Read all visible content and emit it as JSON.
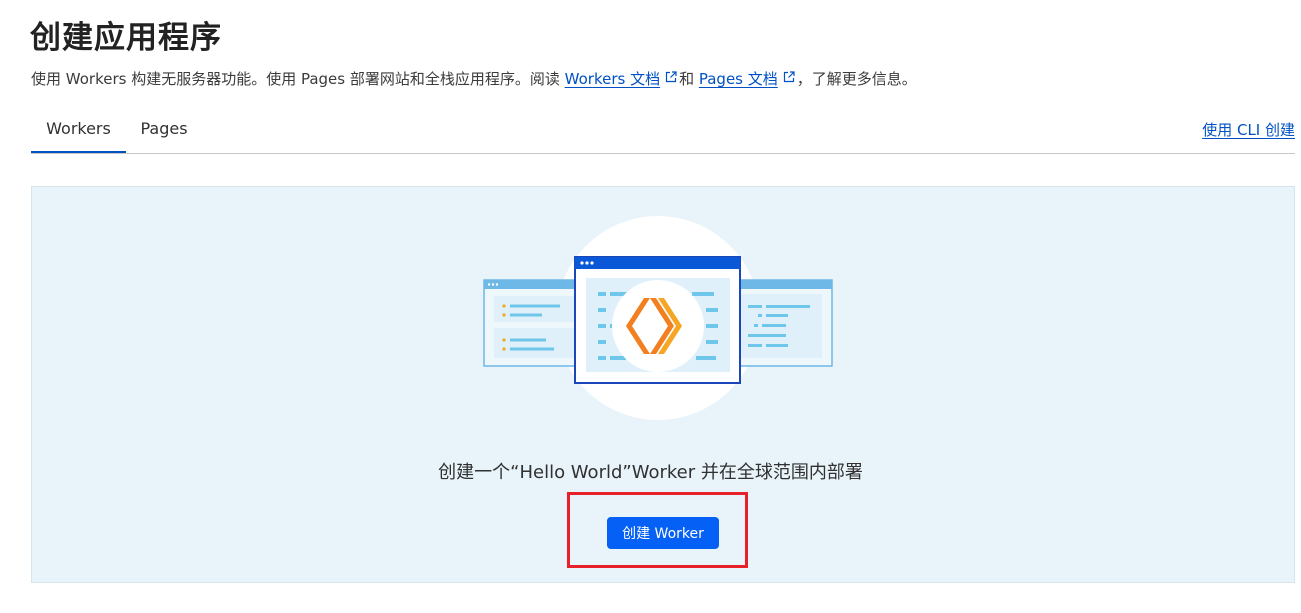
{
  "header": {
    "title": "创建应用程序",
    "subtitle_prefix": "使用 Workers 构建无服务器功能。使用 Pages 部署网站和全栈应用程序。阅读 ",
    "workers_docs_link": "Workers 文档",
    "subtitle_and": "和 ",
    "pages_docs_link": "Pages 文档",
    "subtitle_suffix": "，了解更多信息。"
  },
  "tabs": [
    {
      "label": "Workers",
      "active": true
    },
    {
      "label": "Pages",
      "active": false
    }
  ],
  "cli_link": "使用 CLI 创建",
  "panel": {
    "cta_text": "创建一个“Hello World”Worker 并在全球范围内部署",
    "create_button": "创建 Worker"
  },
  "colors": {
    "link": "#0051c3",
    "button": "#0560f5",
    "panel_bg": "#e8f4fa",
    "highlight": "#e8202a",
    "logo_orange": "#f38020"
  },
  "icons": [
    "external-link-icon",
    "workers-logo-icon"
  ]
}
